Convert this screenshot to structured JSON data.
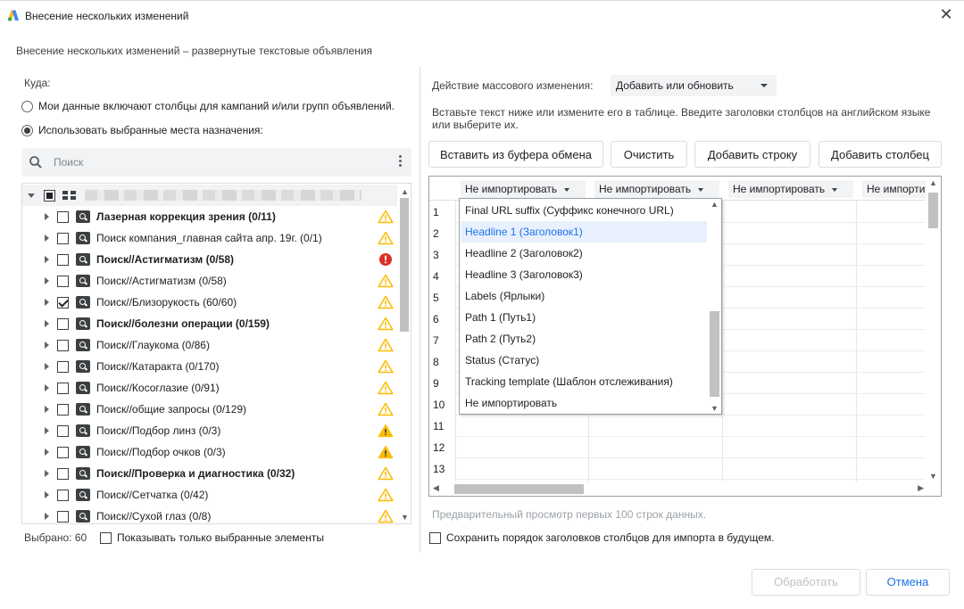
{
  "window": {
    "title": "Внесение нескольких изменений",
    "close_glyph": "✕"
  },
  "subtitle": "Внесение нескольких изменений – развернутые текстовые объявления",
  "destination": {
    "label": "Куда:",
    "options": [
      {
        "label": "Мои данные включают столбцы для кампаний и/или групп объявлений.",
        "checked": false
      },
      {
        "label": "Использовать выбранные места назначения:",
        "checked": true
      }
    ]
  },
  "search": {
    "placeholder": "Поиск",
    "icon": "search-icon"
  },
  "tree": {
    "root_icon": "grid-icon",
    "items": [
      {
        "label": "Лазерная коррекция зрения (0/11)",
        "bold": true,
        "checked": false,
        "status": "warning"
      },
      {
        "label": "Поиск компания_главная сайта апр. 19г. (0/1)",
        "bold": false,
        "checked": false,
        "status": "warning"
      },
      {
        "label": "Поиск//Астигматизм (0/58)",
        "bold": true,
        "checked": false,
        "status": "error"
      },
      {
        "label": "Поиск//Астигматизм (0/58)",
        "bold": false,
        "checked": false,
        "status": "warning"
      },
      {
        "label": "Поиск//Близорукость (60/60)",
        "bold": false,
        "checked": true,
        "status": "warning"
      },
      {
        "label": "Поиск//болезни операции (0/159)",
        "bold": true,
        "checked": false,
        "status": "warning"
      },
      {
        "label": "Поиск//Глаукома (0/86)",
        "bold": false,
        "checked": false,
        "status": "warning"
      },
      {
        "label": "Поиск//Катаракта (0/170)",
        "bold": false,
        "checked": false,
        "status": "warning"
      },
      {
        "label": "Поиск//Косоглазие (0/91)",
        "bold": false,
        "checked": false,
        "status": "warning"
      },
      {
        "label": "Поиск//общие запросы (0/129)",
        "bold": false,
        "checked": false,
        "status": "warning"
      },
      {
        "label": "Поиск//Подбор линз (0/3)",
        "bold": false,
        "checked": false,
        "status": "warning-filled"
      },
      {
        "label": "Поиск//Подбор очков (0/3)",
        "bold": false,
        "checked": false,
        "status": "warning-filled"
      },
      {
        "label": "Поиск//Проверка и диагностика (0/32)",
        "bold": true,
        "checked": false,
        "status": "warning"
      },
      {
        "label": "Поиск//Сетчатка (0/42)",
        "bold": false,
        "checked": false,
        "status": "warning"
      },
      {
        "label": "Поиск//Сухой глаз (0/8)",
        "bold": false,
        "checked": false,
        "status": "warning"
      }
    ]
  },
  "footer_left": {
    "selected": "Выбрано: 60",
    "show_only_selected": "Показывать только выбранные элементы"
  },
  "mass_action": {
    "label": "Действие массового изменения:",
    "value": "Добавить или обновить"
  },
  "instructions": "Вставьте текст ниже или измените его в таблице. Введите заголовки столбцов на английском языке или выберите их.",
  "toolbar": {
    "paste": "Вставить из буфера обмена",
    "clear": "Очистить",
    "add_row": "Добавить строку",
    "add_column": "Добавить столбец"
  },
  "grid": {
    "column_headers": [
      "Не импортировать",
      "Не импортировать",
      "Не импортировать",
      "Не импортировать"
    ],
    "row_numbers": [
      "1",
      "2",
      "3",
      "4",
      "5",
      "6",
      "7",
      "8",
      "9",
      "10",
      "11",
      "12",
      "13"
    ]
  },
  "dropdown": {
    "items": [
      "Final URL suffix (Суффикс конечного URL)",
      "Headline 1 (Заголовок1)",
      "Headline 2 (Заголовок2)",
      "Headline 3 (Заголовок3)",
      "Labels (Ярлыки)",
      "Path 1 (Путь1)",
      "Path 2 (Путь2)",
      "Status (Статус)",
      "Tracking template (Шаблон отслеживания)",
      "Не импортировать"
    ],
    "highlighted_index": 1
  },
  "preview_note": "Предварительный просмотр первых 100 строк данных.",
  "save_order": "Сохранить порядок заголовков столбцов для импорта в будущем.",
  "actions": {
    "process": "Обработать",
    "cancel": "Отмена"
  },
  "colors": {
    "accent": "#1a73e8",
    "warning": "#fbbc04",
    "error": "#d93025",
    "highlight_bg": "#e8f0fe"
  }
}
